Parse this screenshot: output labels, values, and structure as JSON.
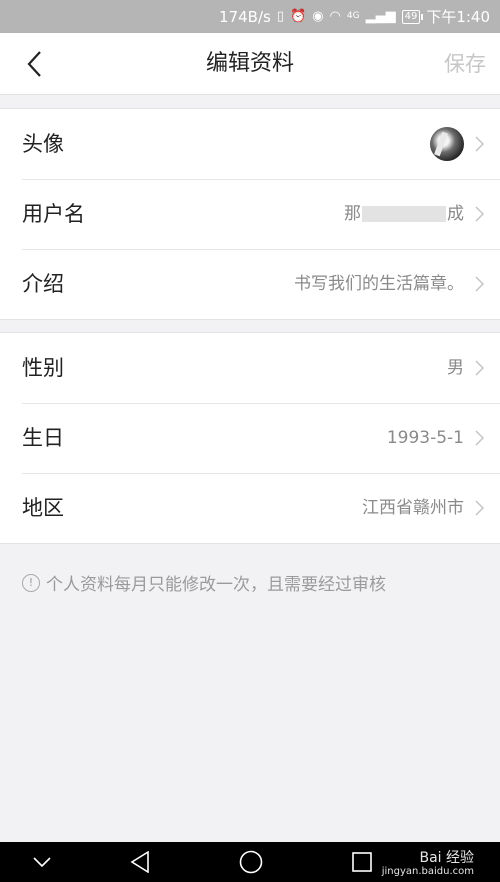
{
  "status_bar": {
    "speed": "174B/s",
    "network": "4G",
    "battery": "49",
    "time": "下午1:40"
  },
  "header": {
    "back_icon": "chevron-left-icon",
    "title": "编辑资料",
    "save_label": "保存"
  },
  "profile_group": {
    "avatar_label": "头像",
    "username_label": "用户名",
    "username_prefix": "那",
    "username_suffix": "成",
    "intro_label": "介绍",
    "intro_value": "书写我们的生活篇章。"
  },
  "info_group": {
    "gender_label": "性别",
    "gender_value": "男",
    "birthday_label": "生日",
    "birthday_value": "1993-5-1",
    "region_label": "地区",
    "region_value": "江西省赣州市"
  },
  "note": {
    "icon": "exclamation-circle-icon",
    "text": "个人资料每月只能修改一次，且需要经过审核"
  },
  "nav_bar": {
    "items": [
      "chevron-down-icon",
      "back-triangle-icon",
      "home-circle-icon",
      "recents-square-icon"
    ]
  },
  "watermark": {
    "main": "Bai 经验",
    "sub": "jingyan.baidu.com"
  }
}
